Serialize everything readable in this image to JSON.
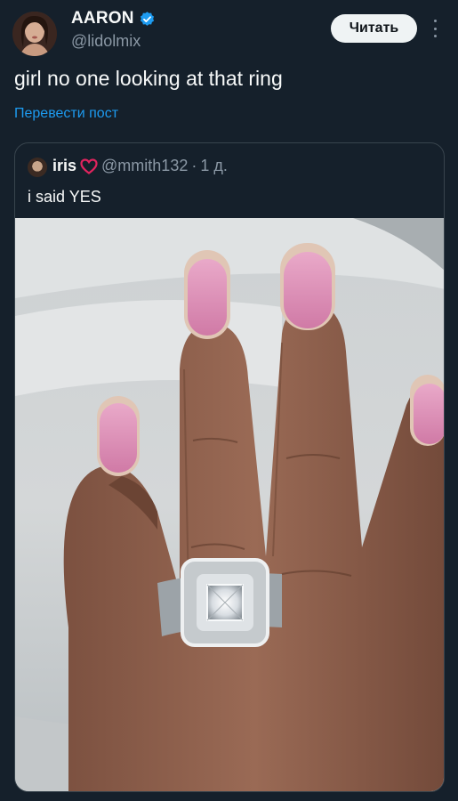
{
  "author": {
    "display_name": "AARON",
    "handle": "@lidolmix",
    "verified": true,
    "avatar_icon": "profile-photo"
  },
  "follow_button": {
    "label": "Читать"
  },
  "more_icon": "vertical-ellipsis-icon",
  "post": {
    "text": "girl no one looking at that ring",
    "translate_label": "Перевести пост"
  },
  "quoted_post": {
    "display_name": "iris",
    "name_emoji": "heart-icon",
    "handle": "@mmith132",
    "separator": "·",
    "time": "1 д.",
    "text": "i said YES",
    "media_icon": "hand-with-ring-photo"
  },
  "colors": {
    "background": "#15202b",
    "link": "#1d9bf0",
    "verified": "#1d9bf0",
    "secondary_text": "#8b98a5",
    "border": "#38444d",
    "nail_pink": "#d98ab4"
  }
}
